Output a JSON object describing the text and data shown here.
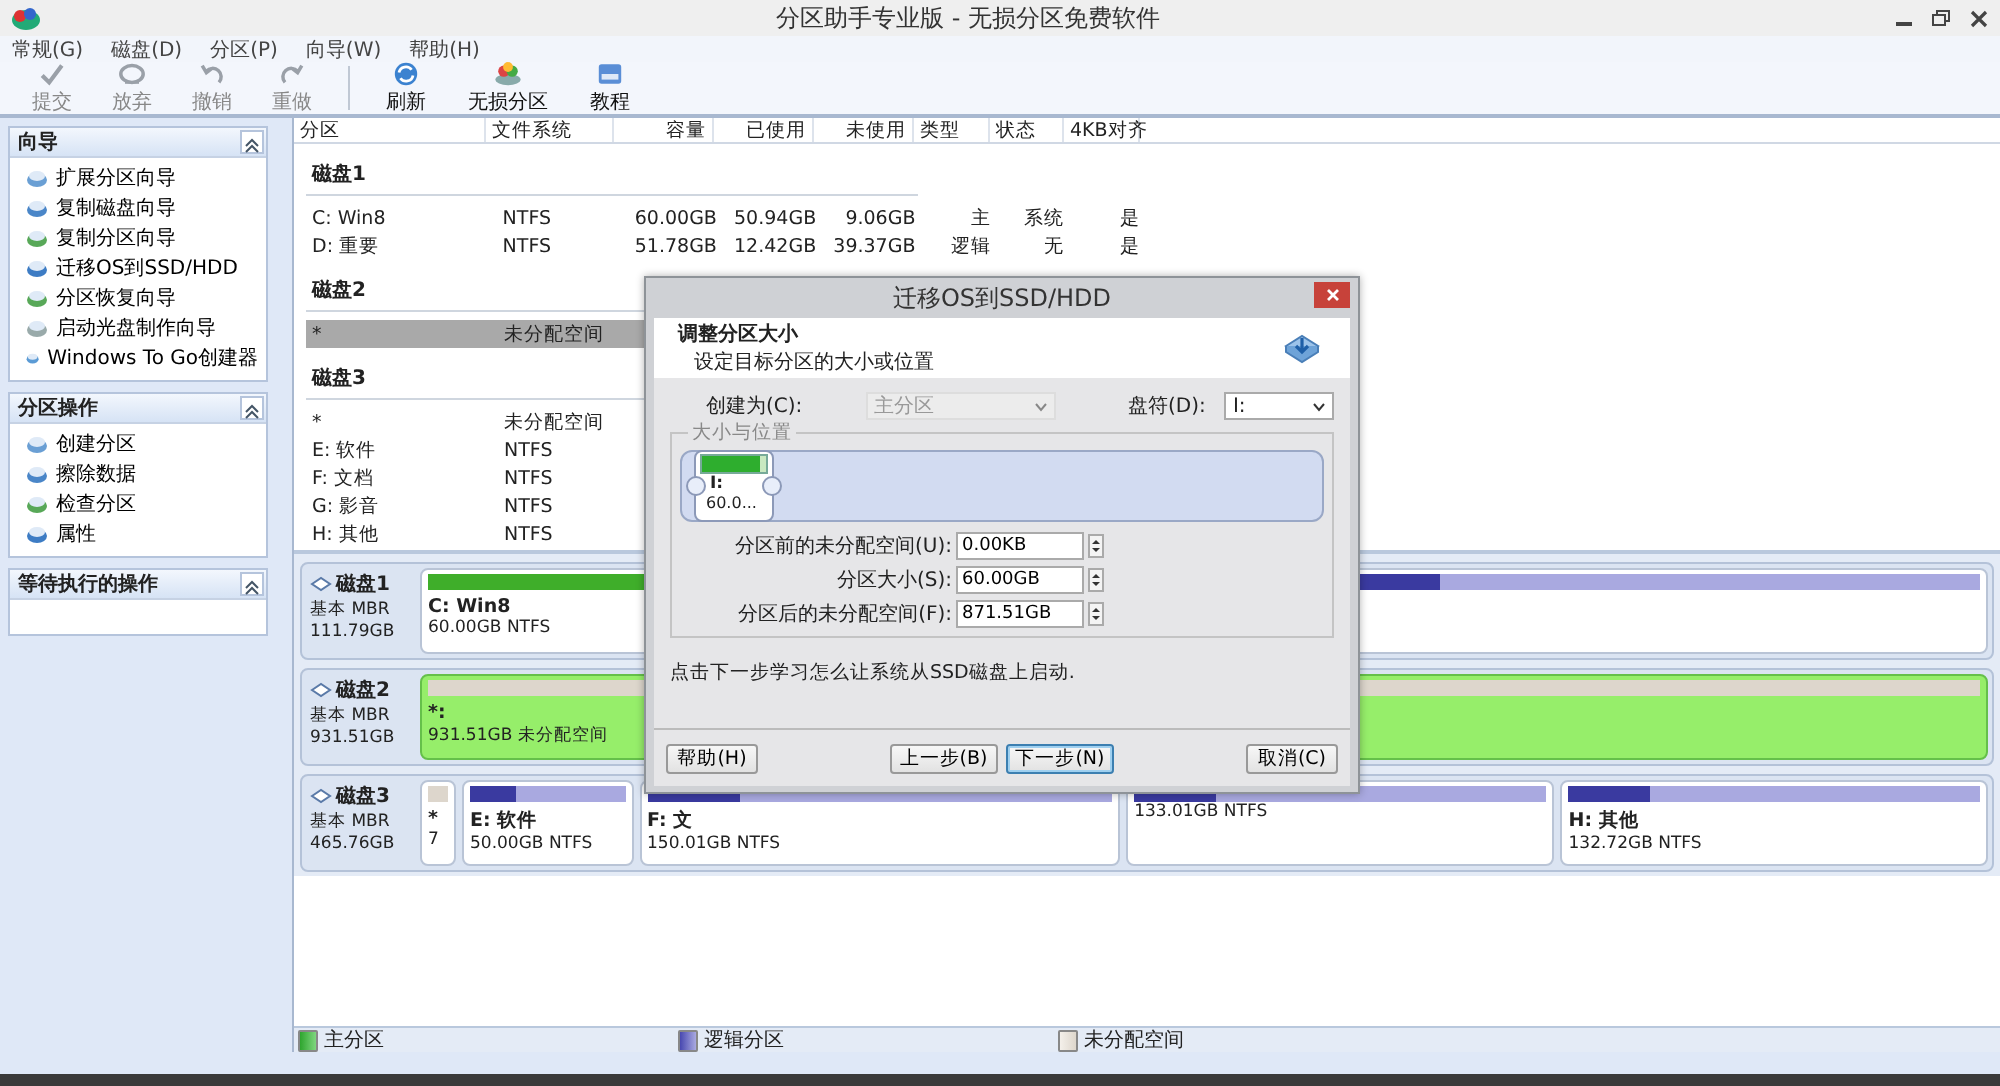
{
  "window": {
    "title": "分区助手专业版 - 无损分区免费软件"
  },
  "menu": [
    "常规(G)",
    "磁盘(D)",
    "分区(P)",
    "向导(W)",
    "帮助(H)"
  ],
  "toolbar": [
    {
      "label": "提交",
      "disabled": true
    },
    {
      "label": "放弃",
      "disabled": true
    },
    {
      "label": "撤销",
      "disabled": true
    },
    {
      "label": "重做",
      "disabled": true
    },
    {
      "label": "刷新",
      "disabled": false
    },
    {
      "label": "无损分区",
      "disabled": false
    },
    {
      "label": "教程",
      "disabled": false
    }
  ],
  "sidebar": [
    {
      "title": "向导",
      "items": [
        "扩展分区向导",
        "复制磁盘向导",
        "复制分区向导",
        "迁移OS到SSD/HDD",
        "分区恢复向导",
        "启动光盘制作向导",
        "Windows To Go创建器"
      ]
    },
    {
      "title": "分区操作",
      "items": [
        "创建分区",
        "擦除数据",
        "检查分区",
        "属性"
      ]
    },
    {
      "title": "等待执行的操作"
    }
  ],
  "table": {
    "columns": [
      "分区",
      "文件系统",
      "容量",
      "已使用",
      "未使用",
      "类型",
      "状态",
      "4KB对齐"
    ],
    "groups": [
      {
        "name": "磁盘1",
        "rows": [
          {
            "cells": [
              "C: Win8",
              "NTFS",
              "60.00GB",
              "50.94GB",
              "9.06GB",
              "主",
              "系统",
              "是"
            ],
            "selected": false
          },
          {
            "cells": [
              "D: 重要",
              "NTFS",
              "51.78GB",
              "12.42GB",
              "39.37GB",
              "逻辑",
              "无",
              "是"
            ],
            "selected": false
          }
        ]
      },
      {
        "name": "磁盘2",
        "rows": [
          {
            "cells": [
              "*",
              "未分配空间"
            ],
            "selected": true
          }
        ]
      },
      {
        "name": "磁盘3",
        "rows": [
          {
            "cells": [
              "*",
              "未分配空间"
            ],
            "selected": false
          },
          {
            "cells": [
              "E: 软件",
              "NTFS"
            ],
            "selected": false
          },
          {
            "cells": [
              "F: 文档",
              "NTFS"
            ],
            "selected": false
          },
          {
            "cells": [
              "G: 影音",
              "NTFS"
            ],
            "selected": false
          },
          {
            "cells": [
              "H: 其他",
              "NTFS"
            ],
            "selected": false
          }
        ]
      }
    ]
  },
  "disks": [
    {
      "name": "磁盘1",
      "type": "基本 MBR",
      "size": "111.79GB",
      "partitions": [
        {
          "kind": "primary",
          "label": "C: Win8",
          "detail": "60.00GB NTFS",
          "level": 0.85,
          "selected": false
        },
        {
          "kind": "logical",
          "level": 0.24,
          "selected": false
        }
      ]
    },
    {
      "name": "磁盘2",
      "type": "基本 MBR",
      "size": "931.51GB",
      "partitions": [
        {
          "kind": "unallocated",
          "label": "*:",
          "detail": "931.51GB 未分配空间",
          "selected": true
        }
      ]
    },
    {
      "name": "磁盘3",
      "type": "基本 MBR",
      "size": "465.76GB",
      "partitions": [
        {
          "kind": "unallocated",
          "label": "*",
          "detail": "7",
          "selected": false
        },
        {
          "kind": "logical",
          "label": "E: 软件",
          "detail": "50.00GB NTFS",
          "level": 0.3,
          "selected": false
        },
        {
          "kind": "logical",
          "label": "F: 文",
          "detail": "150.01GB NTFS",
          "level": 0.2,
          "selected": false
        },
        {
          "kind": "logical",
          "detail": "133.01GB NTFS",
          "level": 0.2,
          "selected": false
        },
        {
          "kind": "logical",
          "label": "H: 其他",
          "detail": "132.72GB NTFS",
          "level": 0.2,
          "selected": false
        }
      ]
    }
  ],
  "legend": [
    {
      "kind": "primary",
      "label": "主分区"
    },
    {
      "kind": "logical",
      "label": "逻辑分区"
    },
    {
      "kind": "unallocated",
      "label": "未分配空间"
    }
  ],
  "dialog": {
    "title": "迁移OS到SSD/HDD",
    "heading": "调整分区大小",
    "subheading": "设定目标分区的大小或位置",
    "create_as": {
      "label": "创建为(C):",
      "value": "主分区",
      "disabled": true
    },
    "drive_letter": {
      "label": "盘符(D):",
      "value": "I:",
      "disabled": false
    },
    "group_title": "大小与位置",
    "partition": {
      "label": "I:",
      "detail": "60.0...",
      "level": 0.9
    },
    "fields": [
      {
        "label": "分区前的未分配空间(U):",
        "value": "0.00KB"
      },
      {
        "label": "分区大小(S):",
        "value": "60.00GB"
      },
      {
        "label": "分区后的未分配空间(F):",
        "value": "871.51GB"
      }
    ],
    "hint": "点击下一步学习怎么让系统从SSD磁盘上启动.",
    "buttons": [
      {
        "label": "帮助(H)",
        "default": false
      },
      {
        "label": "上一步(B)",
        "default": false
      },
      {
        "label": "下一步(N)",
        "default": true
      },
      {
        "label": "取消(C)",
        "default": false
      }
    ]
  }
}
